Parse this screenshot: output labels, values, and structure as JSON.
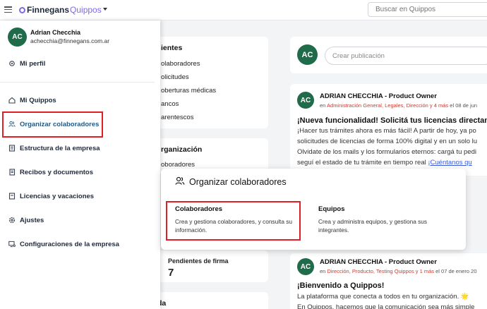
{
  "topbar": {
    "logo_part1": "Finnegans",
    "logo_part2": "Quippos",
    "search_placeholder": "Buscar en Quippos"
  },
  "drawer": {
    "user": {
      "initials": "AC",
      "name": "Adrian Checchia",
      "email": "achecchia@finnegans.com.ar"
    },
    "profile_label": "Mi perfil",
    "items": [
      {
        "label": "Mi Quippos",
        "icon": "home-icon"
      },
      {
        "label": "Organizar colaboradores",
        "icon": "users-icon",
        "active": true
      },
      {
        "label": "Estructura de la empresa",
        "icon": "structure-icon"
      },
      {
        "label": "Recibos y documentos",
        "icon": "document-icon"
      },
      {
        "label": "Licencias y vacaciones",
        "icon": "calendar-icon"
      },
      {
        "label": "Ajustes",
        "icon": "settings-icon"
      },
      {
        "label": "Configuraciones de la empresa",
        "icon": "monitor-gear-icon"
      }
    ]
  },
  "background": {
    "card1_title": "ientes",
    "card1_links": [
      "olaboradores",
      "olicitudes",
      "oberturas médicas",
      "ancos",
      "arentescos"
    ],
    "card2_title": "rganización",
    "card2_link": "oboradores",
    "pending_label": "Pendientes de firma",
    "pending_count": "7",
    "bottom_card_text": "da",
    "create_post_placeholder": "Crear publicación",
    "posts": [
      {
        "initials": "AC",
        "author": "ADRIAN CHECCHIA - Product Owner",
        "meta_prefix": "en ",
        "meta_tags": "Administración General, Legales, Dirección y 4 más",
        "meta_suffix": " el 08 de jun",
        "title": "¡Nueva funcionalidad! Solicitá tus licencias directam",
        "lines": [
          "¡Hacer tus trámites ahora es más fácil! A partir de hoy, ya po",
          "solicitudes de licencias de forma 100% digital y en un solo lu",
          "Olvidate de los mails y los formularios eternos: cargá tu pedi",
          "seguí el estado de tu trámite en tiempo real "
        ],
        "link_text": "¡Cuéntanos qu"
      },
      {
        "initials": "AC",
        "author": "ADRIAN CHECCHIA - Product Owner",
        "meta_prefix": "en ",
        "meta_tags": "Dirección, Producto, Testing Quippos y 1 más",
        "meta_suffix": " el 07 de enero 20",
        "title": "¡Bienvenido a Quippos!",
        "lines": [
          "La plataforma que conecta a todos en tu organización. 🌟",
          "En Quippos, hacemos que la comunicación sea más simple"
        ]
      }
    ]
  },
  "popover": {
    "title": "Organizar colaboradores",
    "options": [
      {
        "title": "Colaboradores",
        "description": "Crea y gestiona colaboradores, y consulta su información."
      },
      {
        "title": "Equipos",
        "description": "Crea y administra equipos, y gestiona sus integrantes."
      }
    ]
  },
  "colors": {
    "brand_purple": "#7b68ee",
    "avatar_green": "#1f6b4a",
    "highlight_red": "#e11d25",
    "tag_red": "#d13a2f",
    "active_blue": "#1e5a8a"
  }
}
